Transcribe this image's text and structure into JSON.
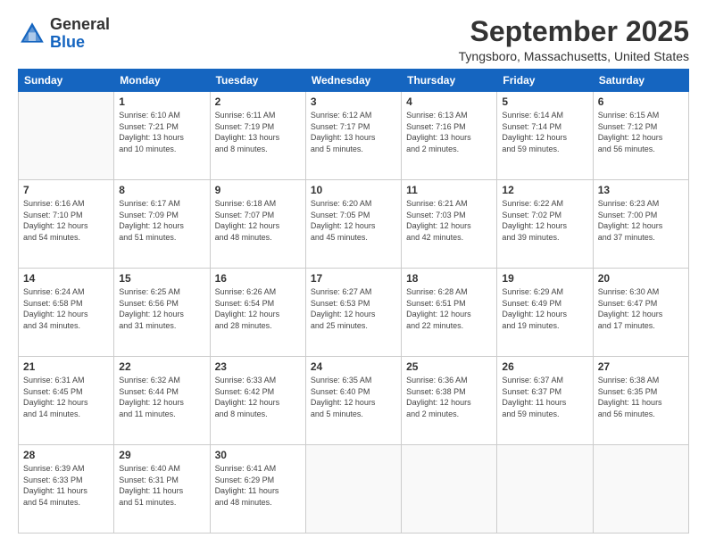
{
  "header": {
    "logo_general": "General",
    "logo_blue": "Blue",
    "month": "September 2025",
    "location": "Tyngsboro, Massachusetts, United States"
  },
  "weekdays": [
    "Sunday",
    "Monday",
    "Tuesday",
    "Wednesday",
    "Thursday",
    "Friday",
    "Saturday"
  ],
  "weeks": [
    [
      {
        "day": "",
        "info": ""
      },
      {
        "day": "1",
        "info": "Sunrise: 6:10 AM\nSunset: 7:21 PM\nDaylight: 13 hours\nand 10 minutes."
      },
      {
        "day": "2",
        "info": "Sunrise: 6:11 AM\nSunset: 7:19 PM\nDaylight: 13 hours\nand 8 minutes."
      },
      {
        "day": "3",
        "info": "Sunrise: 6:12 AM\nSunset: 7:17 PM\nDaylight: 13 hours\nand 5 minutes."
      },
      {
        "day": "4",
        "info": "Sunrise: 6:13 AM\nSunset: 7:16 PM\nDaylight: 13 hours\nand 2 minutes."
      },
      {
        "day": "5",
        "info": "Sunrise: 6:14 AM\nSunset: 7:14 PM\nDaylight: 12 hours\nand 59 minutes."
      },
      {
        "day": "6",
        "info": "Sunrise: 6:15 AM\nSunset: 7:12 PM\nDaylight: 12 hours\nand 56 minutes."
      }
    ],
    [
      {
        "day": "7",
        "info": "Sunrise: 6:16 AM\nSunset: 7:10 PM\nDaylight: 12 hours\nand 54 minutes."
      },
      {
        "day": "8",
        "info": "Sunrise: 6:17 AM\nSunset: 7:09 PM\nDaylight: 12 hours\nand 51 minutes."
      },
      {
        "day": "9",
        "info": "Sunrise: 6:18 AM\nSunset: 7:07 PM\nDaylight: 12 hours\nand 48 minutes."
      },
      {
        "day": "10",
        "info": "Sunrise: 6:20 AM\nSunset: 7:05 PM\nDaylight: 12 hours\nand 45 minutes."
      },
      {
        "day": "11",
        "info": "Sunrise: 6:21 AM\nSunset: 7:03 PM\nDaylight: 12 hours\nand 42 minutes."
      },
      {
        "day": "12",
        "info": "Sunrise: 6:22 AM\nSunset: 7:02 PM\nDaylight: 12 hours\nand 39 minutes."
      },
      {
        "day": "13",
        "info": "Sunrise: 6:23 AM\nSunset: 7:00 PM\nDaylight: 12 hours\nand 37 minutes."
      }
    ],
    [
      {
        "day": "14",
        "info": "Sunrise: 6:24 AM\nSunset: 6:58 PM\nDaylight: 12 hours\nand 34 minutes."
      },
      {
        "day": "15",
        "info": "Sunrise: 6:25 AM\nSunset: 6:56 PM\nDaylight: 12 hours\nand 31 minutes."
      },
      {
        "day": "16",
        "info": "Sunrise: 6:26 AM\nSunset: 6:54 PM\nDaylight: 12 hours\nand 28 minutes."
      },
      {
        "day": "17",
        "info": "Sunrise: 6:27 AM\nSunset: 6:53 PM\nDaylight: 12 hours\nand 25 minutes."
      },
      {
        "day": "18",
        "info": "Sunrise: 6:28 AM\nSunset: 6:51 PM\nDaylight: 12 hours\nand 22 minutes."
      },
      {
        "day": "19",
        "info": "Sunrise: 6:29 AM\nSunset: 6:49 PM\nDaylight: 12 hours\nand 19 minutes."
      },
      {
        "day": "20",
        "info": "Sunrise: 6:30 AM\nSunset: 6:47 PM\nDaylight: 12 hours\nand 17 minutes."
      }
    ],
    [
      {
        "day": "21",
        "info": "Sunrise: 6:31 AM\nSunset: 6:45 PM\nDaylight: 12 hours\nand 14 minutes."
      },
      {
        "day": "22",
        "info": "Sunrise: 6:32 AM\nSunset: 6:44 PM\nDaylight: 12 hours\nand 11 minutes."
      },
      {
        "day": "23",
        "info": "Sunrise: 6:33 AM\nSunset: 6:42 PM\nDaylight: 12 hours\nand 8 minutes."
      },
      {
        "day": "24",
        "info": "Sunrise: 6:35 AM\nSunset: 6:40 PM\nDaylight: 12 hours\nand 5 minutes."
      },
      {
        "day": "25",
        "info": "Sunrise: 6:36 AM\nSunset: 6:38 PM\nDaylight: 12 hours\nand 2 minutes."
      },
      {
        "day": "26",
        "info": "Sunrise: 6:37 AM\nSunset: 6:37 PM\nDaylight: 11 hours\nand 59 minutes."
      },
      {
        "day": "27",
        "info": "Sunrise: 6:38 AM\nSunset: 6:35 PM\nDaylight: 11 hours\nand 56 minutes."
      }
    ],
    [
      {
        "day": "28",
        "info": "Sunrise: 6:39 AM\nSunset: 6:33 PM\nDaylight: 11 hours\nand 54 minutes."
      },
      {
        "day": "29",
        "info": "Sunrise: 6:40 AM\nSunset: 6:31 PM\nDaylight: 11 hours\nand 51 minutes."
      },
      {
        "day": "30",
        "info": "Sunrise: 6:41 AM\nSunset: 6:29 PM\nDaylight: 11 hours\nand 48 minutes."
      },
      {
        "day": "",
        "info": ""
      },
      {
        "day": "",
        "info": ""
      },
      {
        "day": "",
        "info": ""
      },
      {
        "day": "",
        "info": ""
      }
    ]
  ]
}
